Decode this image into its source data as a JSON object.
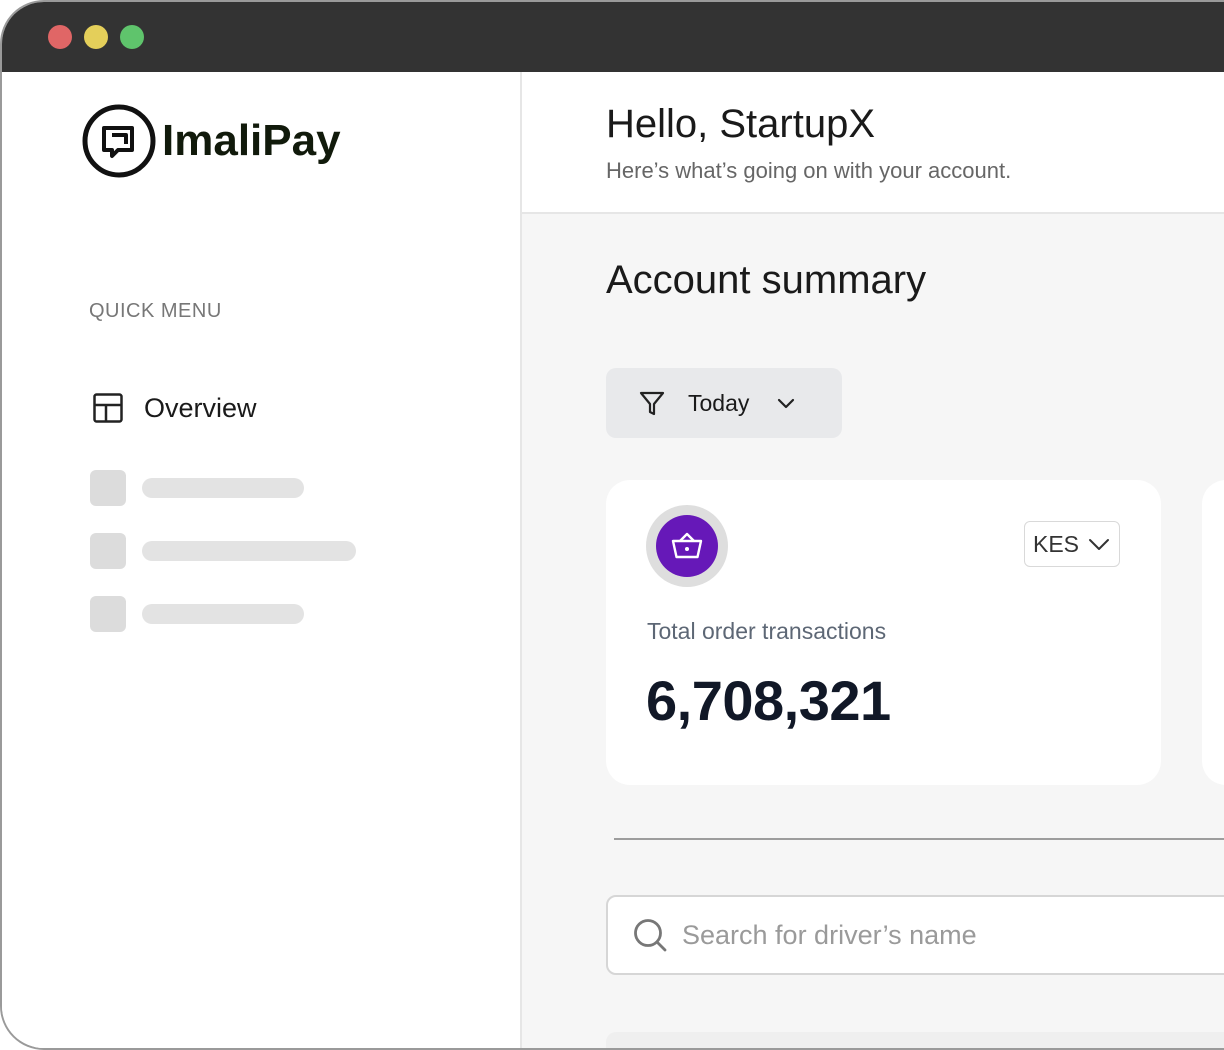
{
  "window": {
    "controls": {
      "close_color": "#e06666",
      "minimize_color": "#e4cf5a",
      "maximize_color": "#5fc46c"
    }
  },
  "brand": {
    "name": "ImaliPay",
    "logo_icon": "imalipay-logo-icon"
  },
  "sidebar": {
    "section_label": "QUICK MENU",
    "items": [
      {
        "label": "Overview",
        "icon": "layout-icon"
      }
    ]
  },
  "header": {
    "greeting": "Hello, StartupX",
    "subtitle": "Here’s what’s going on with your account."
  },
  "main": {
    "section_title": "Account summary",
    "filter": {
      "label": "Today",
      "icon": "filter-icon"
    },
    "card": {
      "icon": "basket-icon",
      "accent_color": "#6618b8",
      "currency": "KES",
      "label": "Total order transactions",
      "value": "6,708,321"
    },
    "search": {
      "placeholder": "Search for driver’s name",
      "value": ""
    }
  }
}
